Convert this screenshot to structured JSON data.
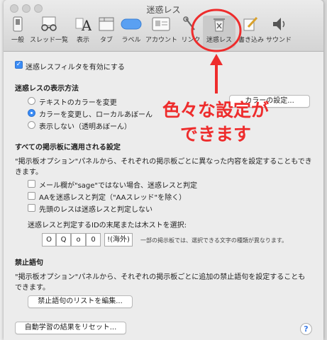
{
  "window": {
    "title": "迷惑レス"
  },
  "toolbar": {
    "items": [
      {
        "label": "一般",
        "icon": "switch-icon"
      },
      {
        "label": "スレッド一覧",
        "icon": "glasses-icon"
      },
      {
        "label": "表示",
        "icon": "font-a-icon"
      },
      {
        "label": "タブ",
        "icon": "tab-window-icon"
      },
      {
        "label": "ラベル",
        "icon": "label-pill-icon"
      },
      {
        "label": "アカウント",
        "icon": "id-card-icon"
      },
      {
        "label": "リンク",
        "icon": "link-icon"
      },
      {
        "label": "迷惑レス",
        "icon": "trash-icon",
        "selected": true
      },
      {
        "label": "書き込み",
        "icon": "pencil-icon"
      },
      {
        "label": "サウンド",
        "icon": "speaker-icon"
      }
    ]
  },
  "spam_filter": {
    "enable_label": "迷惑レスフィルタを有効にする",
    "enabled": true
  },
  "display_method": {
    "header": "迷惑レスの表示方法",
    "options": [
      "テキストのカラーを変更",
      "カラーを変更し、ローカルあぼーん",
      "表示しない（透明あぼーん）"
    ],
    "selected_index": 1,
    "color_button": "カラーの設定..."
  },
  "all_boards": {
    "header": "すべての掲示板に適用される設定",
    "description_line1": "\"掲示板オプション\"パネルから、それぞれの掲示板ごとに異なった内容を設定することもでき",
    "description_line2": "きます。",
    "checkboxes": [
      "メール欄が\"sage\"ではない場合、迷惑レスと判定",
      "AAを迷惑レスと判定（\"AAスレッド\"を除く）",
      "先頭のレスは迷惑レスと判定しない"
    ],
    "id_label": "迷惑レスと判定するIDの末尾または木ストを選択:",
    "id_fields": [
      "O",
      "Q",
      "o",
      "0",
      "!(海外)"
    ],
    "id_note": "一部の掲示板では、選択できる文字の種類が異なります。"
  },
  "ng_words": {
    "header": "禁止語句",
    "description_line1": "\"掲示板オプション\"パネルから、それぞれの掲示板ごとに追加の禁止語句を設定することも",
    "description_line2": "できます。",
    "edit_button": "禁止語句のリストを編集..."
  },
  "reset_button": "自動学習の結果をリセット...",
  "help_label": "?",
  "annotation": {
    "line1": "色々な設定が",
    "line2": "できます",
    "color": "#ee2c2c"
  },
  "colors": {
    "accent": "#3b8cf5",
    "annotation": "#ee2c2c"
  }
}
